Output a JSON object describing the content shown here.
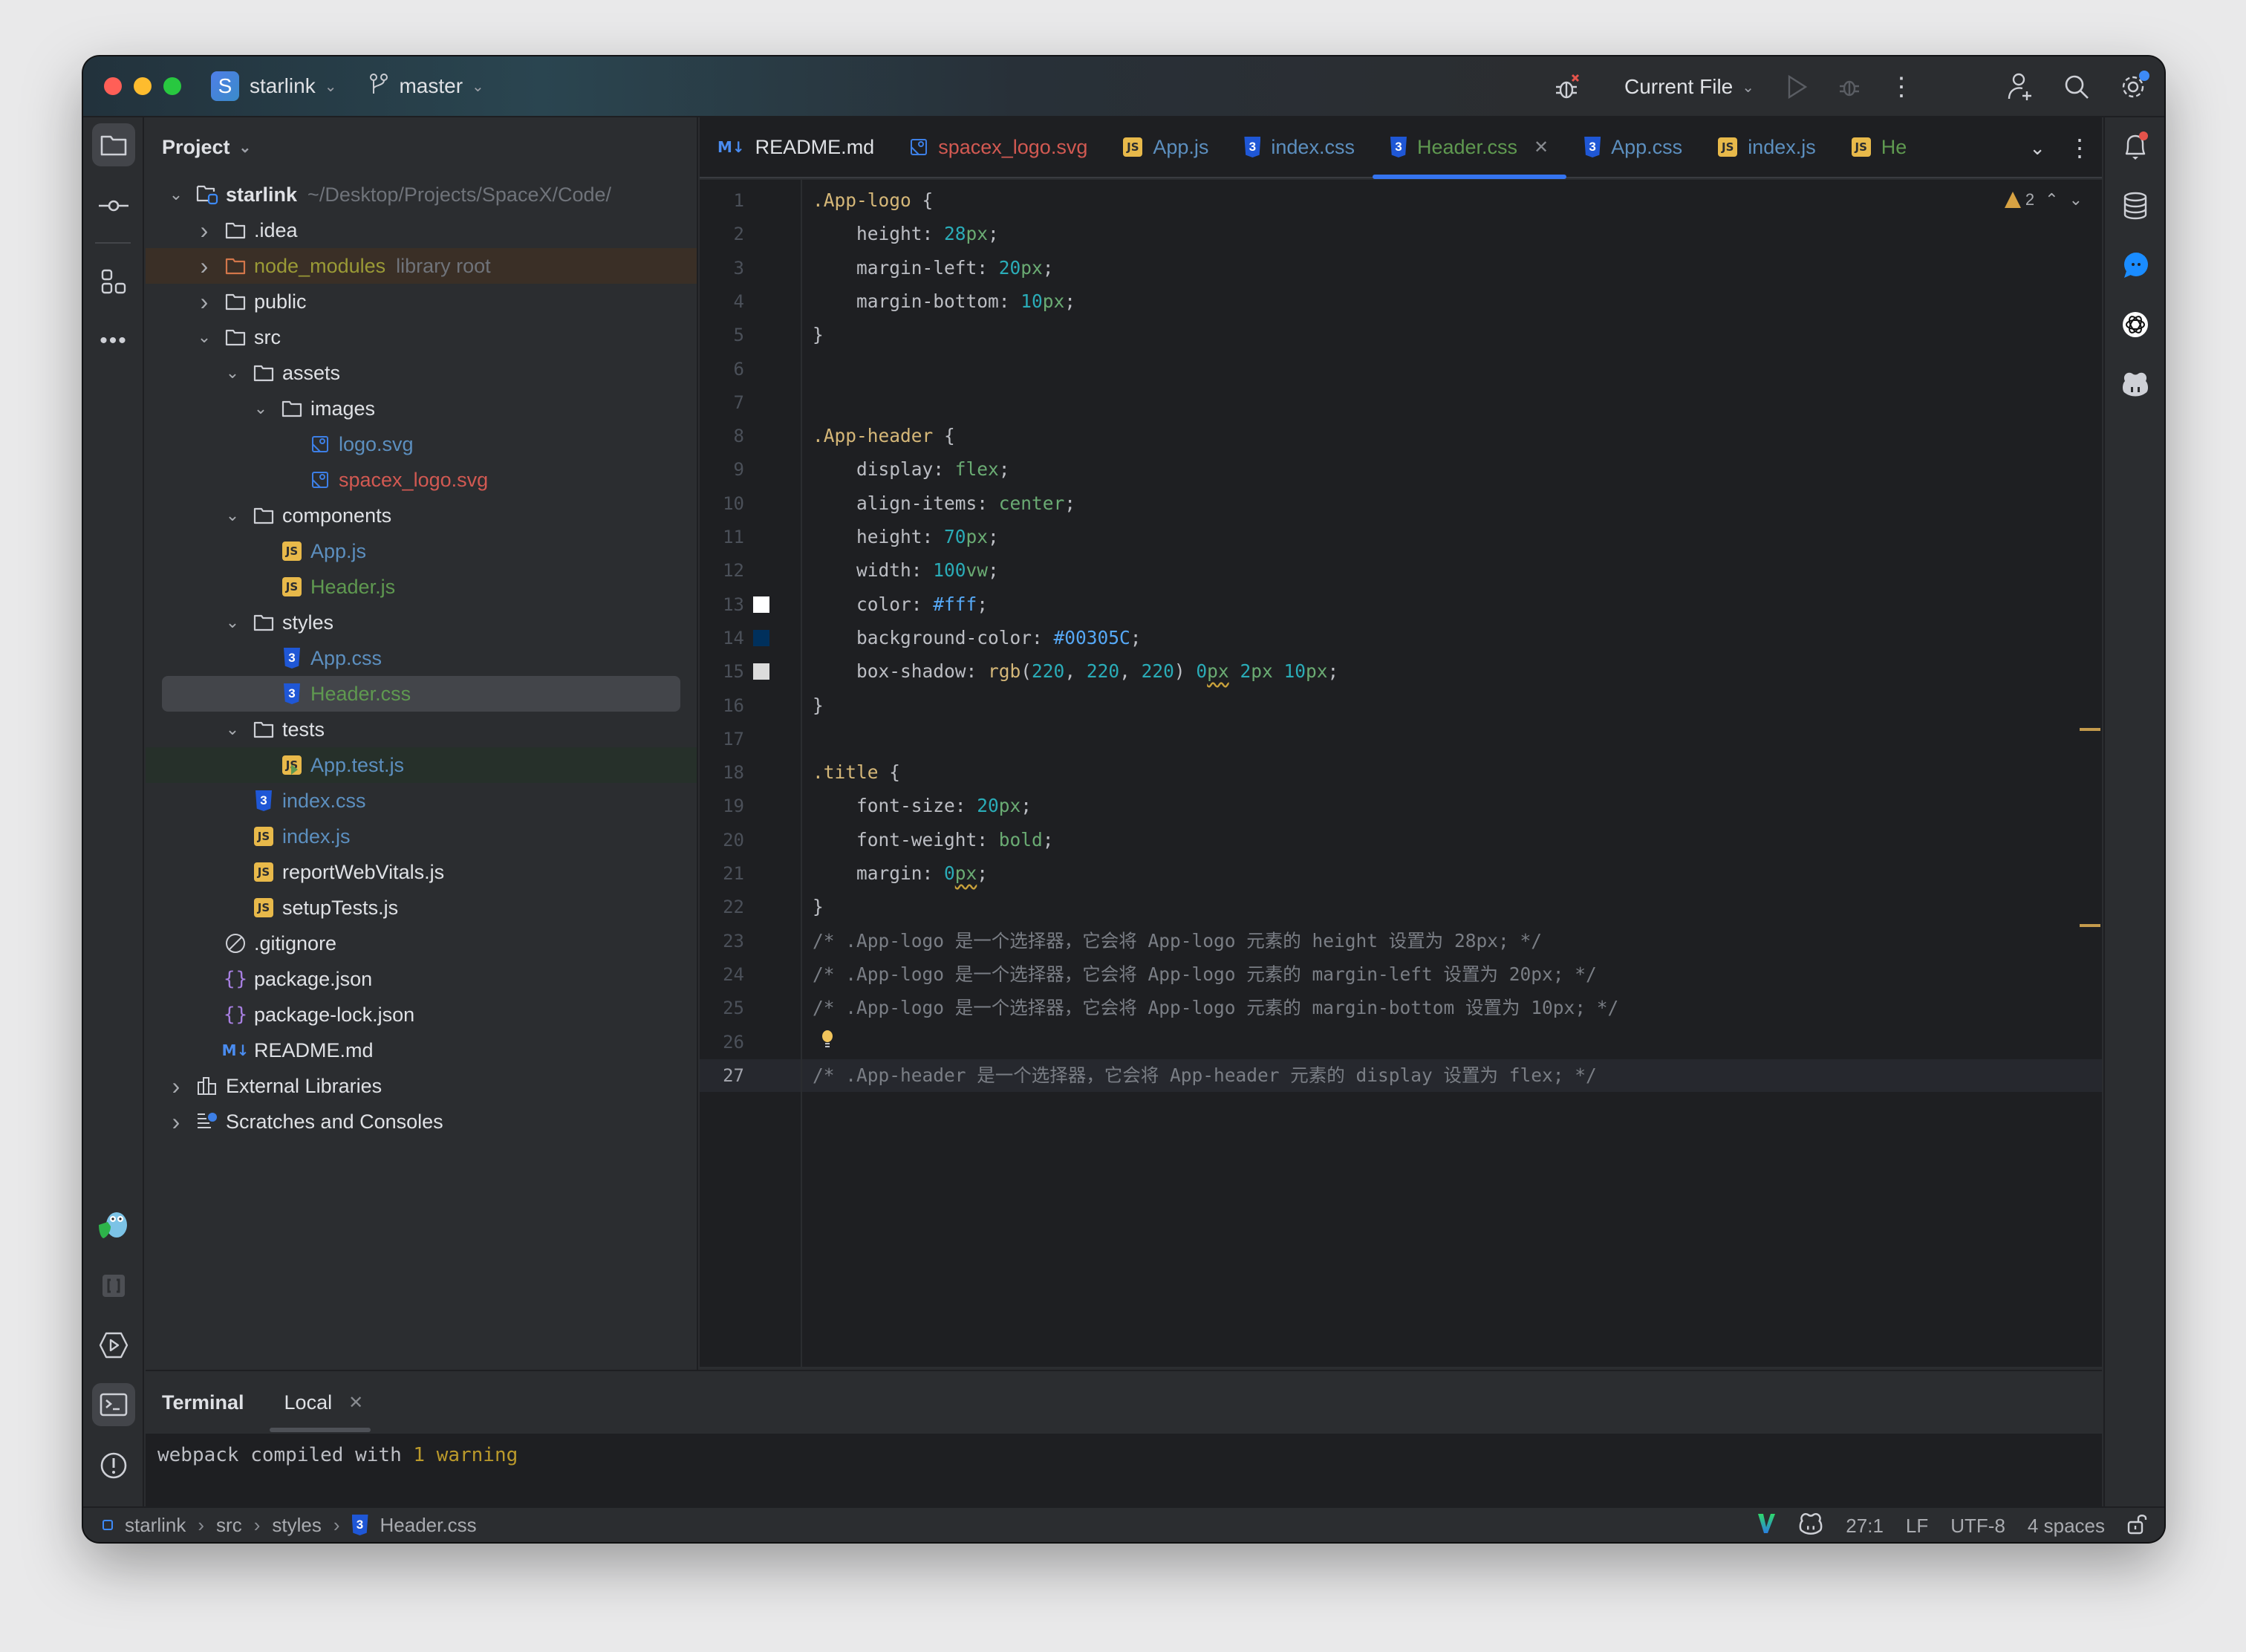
{
  "window": {
    "project_name": "starlink",
    "project_badge": "S",
    "branch": "master",
    "run_config": "Current File"
  },
  "project_panel": {
    "title": "Project",
    "tree": [
      {
        "label": "starlink",
        "hint": "~/Desktop/Projects/SpaceX/Code/",
        "type": "root",
        "depth": 0,
        "expanded": true
      },
      {
        "label": ".idea",
        "type": "folder",
        "depth": 1,
        "expanded": false
      },
      {
        "label": "node_modules",
        "hint": "library root",
        "type": "folder-lib",
        "depth": 1,
        "expanded": false
      },
      {
        "label": "public",
        "type": "folder",
        "depth": 1,
        "expanded": false
      },
      {
        "label": "src",
        "type": "folder",
        "depth": 1,
        "expanded": true
      },
      {
        "label": "assets",
        "type": "folder",
        "depth": 2,
        "expanded": true
      },
      {
        "label": "images",
        "type": "folder",
        "depth": 3,
        "expanded": true
      },
      {
        "label": "logo.svg",
        "type": "svg",
        "depth": 4,
        "color": "blue"
      },
      {
        "label": "spacex_logo.svg",
        "type": "svg",
        "depth": 4,
        "color": "red"
      },
      {
        "label": "components",
        "type": "folder",
        "depth": 2,
        "expanded": true
      },
      {
        "label": "App.js",
        "type": "js",
        "depth": 3,
        "color": "blue"
      },
      {
        "label": "Header.js",
        "type": "js",
        "depth": 3,
        "color": "green"
      },
      {
        "label": "styles",
        "type": "folder",
        "depth": 2,
        "expanded": true
      },
      {
        "label": "App.css",
        "type": "css",
        "depth": 3,
        "color": "blue"
      },
      {
        "label": "Header.css",
        "type": "css",
        "depth": 3,
        "color": "green",
        "selected": true
      },
      {
        "label": "tests",
        "type": "folder",
        "depth": 2,
        "expanded": true
      },
      {
        "label": "App.test.js",
        "type": "jstest",
        "depth": 3,
        "color": "blue"
      },
      {
        "label": "index.css",
        "type": "css",
        "depth": 2,
        "color": "blue"
      },
      {
        "label": "index.js",
        "type": "js",
        "depth": 2,
        "color": "blue"
      },
      {
        "label": "reportWebVitals.js",
        "type": "js",
        "depth": 2,
        "color": "white"
      },
      {
        "label": "setupTests.js",
        "type": "js",
        "depth": 2,
        "color": "white"
      },
      {
        "label": ".gitignore",
        "type": "ignore",
        "depth": 1,
        "color": "white"
      },
      {
        "label": "package.json",
        "type": "json",
        "depth": 1,
        "color": "white"
      },
      {
        "label": "package-lock.json",
        "type": "json",
        "depth": 1,
        "color": "white"
      },
      {
        "label": "README.md",
        "type": "md",
        "depth": 1,
        "color": "white"
      },
      {
        "label": "External Libraries",
        "type": "extlib",
        "depth": 0,
        "expanded": false
      },
      {
        "label": "Scratches and Consoles",
        "type": "scratch",
        "depth": 0,
        "expanded": false
      }
    ]
  },
  "tabs": [
    {
      "label": "README.md",
      "type": "md",
      "color": "#dfe1e5"
    },
    {
      "label": "spacex_logo.svg",
      "type": "svg",
      "color": "#d25952"
    },
    {
      "label": "App.js",
      "type": "js",
      "color": "#5c8fbf"
    },
    {
      "label": "index.css",
      "type": "css",
      "color": "#5c8fbf"
    },
    {
      "label": "Header.css",
      "type": "css",
      "color": "#5f9950",
      "active": true,
      "closable": true
    },
    {
      "label": "App.css",
      "type": "css",
      "color": "#5c8fbf"
    },
    {
      "label": "index.js",
      "type": "js",
      "color": "#5c8fbf"
    },
    {
      "label": "He",
      "type": "js",
      "color": "#5f9950"
    }
  ],
  "editor": {
    "warnings_count": "2",
    "current_line": 27,
    "lines": [
      [
        [
          "sel",
          ".App-logo"
        ],
        [
          "p",
          " {"
        ]
      ],
      [
        [
          "p",
          "    height: "
        ],
        [
          "num",
          "28"
        ],
        [
          "unit",
          "px"
        ],
        [
          "p",
          ";"
        ]
      ],
      [
        [
          "p",
          "    margin-left: "
        ],
        [
          "num",
          "20"
        ],
        [
          "unit",
          "px"
        ],
        [
          "p",
          ";"
        ]
      ],
      [
        [
          "p",
          "    margin-bottom: "
        ],
        [
          "num",
          "10"
        ],
        [
          "unit",
          "px"
        ],
        [
          "p",
          ";"
        ]
      ],
      [
        [
          "p",
          "}"
        ]
      ],
      [],
      [],
      [
        [
          "sel",
          ".App-header"
        ],
        [
          "p",
          " {"
        ]
      ],
      [
        [
          "p",
          "    display: "
        ],
        [
          "kw",
          "flex"
        ],
        [
          "p",
          ";"
        ]
      ],
      [
        [
          "p",
          "    align-items: "
        ],
        [
          "kw",
          "center"
        ],
        [
          "p",
          ";"
        ]
      ],
      [
        [
          "p",
          "    height: "
        ],
        [
          "num",
          "70"
        ],
        [
          "unit",
          "px"
        ],
        [
          "p",
          ";"
        ]
      ],
      [
        [
          "p",
          "    width: "
        ],
        [
          "num",
          "100"
        ],
        [
          "unit",
          "vw"
        ],
        [
          "p",
          ";"
        ]
      ],
      [
        [
          "p",
          "    color: "
        ],
        [
          "hex",
          "#fff"
        ],
        [
          "p",
          ";"
        ]
      ],
      [
        [
          "p",
          "    background-color: "
        ],
        [
          "hex",
          "#00305C"
        ],
        [
          "p",
          ";"
        ]
      ],
      [
        [
          "p",
          "    box-shadow: "
        ],
        [
          "fn",
          "rgb"
        ],
        [
          "p",
          "("
        ],
        [
          "num",
          "220"
        ],
        [
          "p",
          ", "
        ],
        [
          "num",
          "220"
        ],
        [
          "p",
          ", "
        ],
        [
          "num",
          "220"
        ],
        [
          "p",
          ") "
        ],
        [
          "num",
          "0"
        ],
        [
          "unitsq",
          "px"
        ],
        [
          "p",
          " "
        ],
        [
          "num",
          "2"
        ],
        [
          "unit",
          "px"
        ],
        [
          "p",
          " "
        ],
        [
          "num",
          "10"
        ],
        [
          "unit",
          "px"
        ],
        [
          "p",
          ";"
        ]
      ],
      [
        [
          "p",
          "}"
        ]
      ],
      [],
      [
        [
          "sel",
          ".title"
        ],
        [
          "p",
          " {"
        ]
      ],
      [
        [
          "p",
          "    font-size: "
        ],
        [
          "num",
          "20"
        ],
        [
          "unit",
          "px"
        ],
        [
          "p",
          ";"
        ]
      ],
      [
        [
          "p",
          "    font-weight: "
        ],
        [
          "kw",
          "bold"
        ],
        [
          "p",
          ";"
        ]
      ],
      [
        [
          "p",
          "    margin: "
        ],
        [
          "num",
          "0"
        ],
        [
          "unitsq",
          "px"
        ],
        [
          "p",
          ";"
        ]
      ],
      [
        [
          "p",
          "}"
        ]
      ],
      [
        [
          "cm",
          "/* .App-logo 是一个选择器，它会将 App-logo 元素的 height 设置为 28px; */"
        ]
      ],
      [
        [
          "cm",
          "/* .App-logo 是一个选择器，它会将 App-logo 元素的 margin-left 设置为 20px; */"
        ]
      ],
      [
        [
          "cm",
          "/* .App-logo 是一个选择器，它会将 App-logo 元素的 margin-bottom 设置为 10px; */"
        ]
      ],
      [],
      [
        [
          "cm",
          "/* .App-header 是一个选择器，它会将 App-header 元素的 display 设置为 flex; */"
        ]
      ]
    ],
    "swatches": [
      {
        "line": 13,
        "color": "#ffffff"
      },
      {
        "line": 14,
        "color": "#00305C"
      },
      {
        "line": 15,
        "color": "#dcdcdc"
      }
    ],
    "bulb_line": 26
  },
  "terminal": {
    "title": "Terminal",
    "tab": "Local",
    "output_prefix": "webpack compiled with ",
    "output_warning": "1 warning"
  },
  "statusbar": {
    "breadcrumb": [
      "starlink",
      "src",
      "styles",
      "Header.css"
    ],
    "position": "27:1",
    "line_ending": "LF",
    "encoding": "UTF-8",
    "indent": "4 spaces"
  }
}
